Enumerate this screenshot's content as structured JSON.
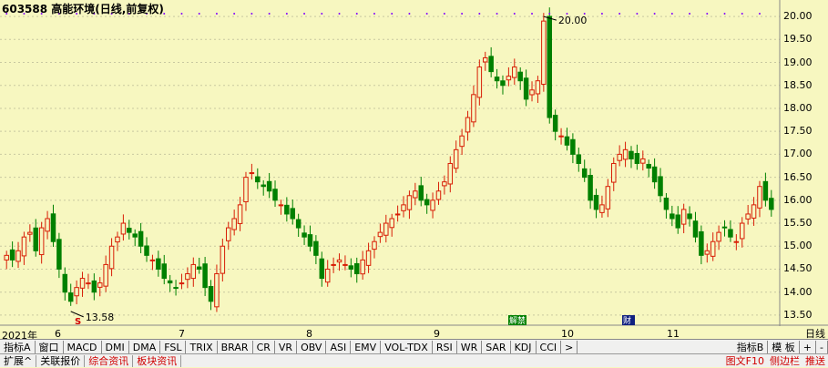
{
  "header": {
    "title": "603588 高能环境(日线,前复权)"
  },
  "axis": {
    "yticks": [
      "20.00",
      "19.50",
      "19.00",
      "18.50",
      "18.00",
      "17.50",
      "17.00",
      "16.50",
      "16.00",
      "15.50",
      "15.00",
      "14.50",
      "14.00",
      "13.50"
    ],
    "months": [
      "2021年",
      "6",
      "7",
      "8",
      "9",
      "10",
      "11"
    ],
    "period": "日线"
  },
  "annotations": {
    "high": "20.00",
    "low": "13.58",
    "marker_s": "S",
    "marker_jie": "解禁",
    "marker_cai": "财"
  },
  "chart_data": {
    "type": "candlestick",
    "title": "603588 高能环境(日线,前复权)",
    "x_months": [
      "2021年",
      "6",
      "7",
      "8",
      "9",
      "10",
      "11"
    ],
    "ylim": [
      13.3,
      20.2
    ],
    "high": 20.0,
    "low": 13.58,
    "close_series": [
      14.8,
      14.7,
      14.9,
      15.2,
      15.3,
      14.9,
      15.4,
      15.6,
      15.1,
      14.5,
      14.0,
      13.8,
      14.1,
      14.3,
      14.2,
      14.0,
      14.2,
      14.6,
      15.0,
      15.2,
      15.5,
      15.3,
      15.2,
      15.0,
      14.8,
      14.7,
      14.5,
      14.3,
      14.2,
      14.1,
      14.2,
      14.4,
      14.6,
      14.5,
      14.1,
      13.8,
      14.4,
      15.0,
      15.4,
      15.6,
      15.9,
      16.5,
      16.6,
      16.4,
      16.3,
      16.2,
      16.0,
      15.9,
      15.7,
      15.6,
      15.4,
      15.2,
      15.0,
      14.8,
      14.3,
      14.5,
      14.6,
      14.7,
      14.6,
      14.5,
      14.4,
      14.7,
      14.9,
      15.1,
      15.3,
      15.5,
      15.6,
      15.7,
      15.9,
      16.1,
      16.2,
      16.0,
      15.9,
      16.0,
      16.2,
      16.4,
      16.8,
      17.1,
      17.4,
      17.8,
      18.3,
      18.9,
      19.1,
      18.8,
      18.6,
      18.5,
      18.7,
      18.9,
      18.6,
      18.2,
      18.4,
      18.6,
      19.9,
      17.8,
      17.5,
      17.4,
      17.2,
      17.0,
      16.8,
      16.5,
      16.0,
      15.8,
      15.9,
      16.3,
      16.8,
      17.0,
      17.1,
      16.9,
      16.8,
      16.9,
      16.7,
      16.4,
      16.1,
      15.8,
      15.6,
      15.4,
      15.8,
      15.6,
      15.2,
      14.8,
      14.9,
      15.1,
      15.3,
      15.4,
      15.2,
      15.1,
      15.5,
      15.7,
      15.9,
      16.3,
      16.0,
      15.8
    ]
  }
}
